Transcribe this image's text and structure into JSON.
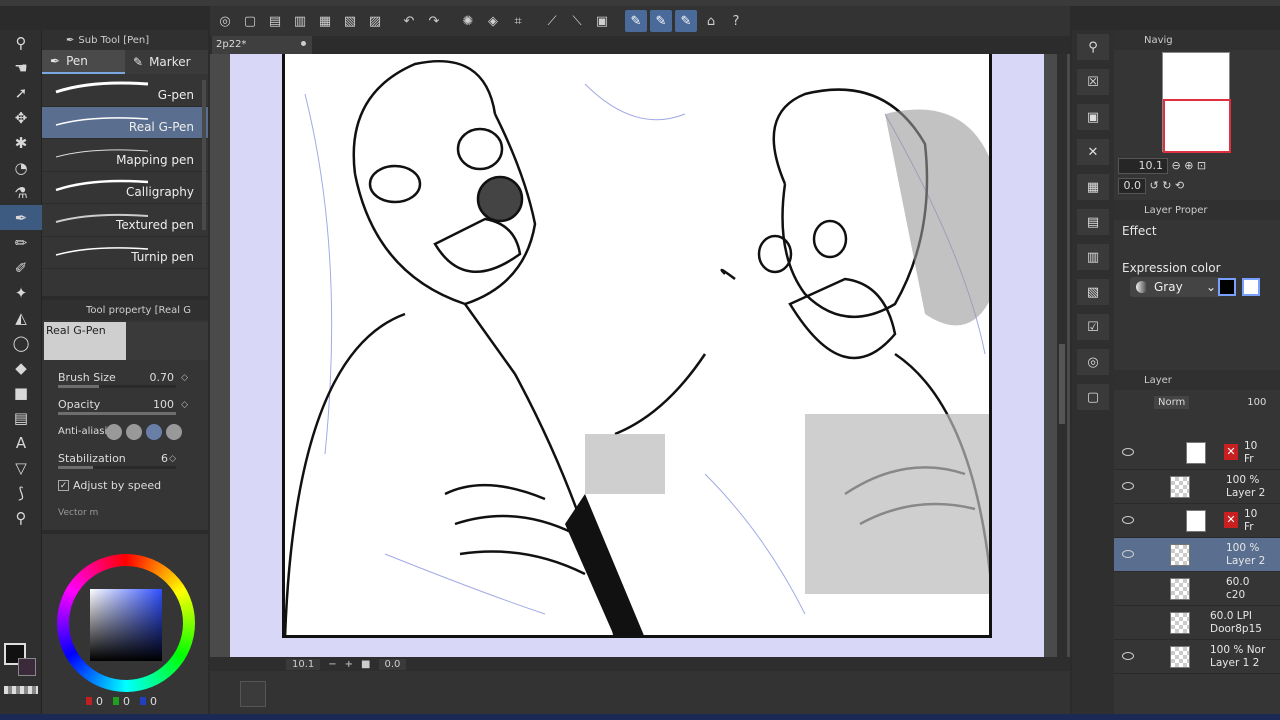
{
  "document": {
    "tab_name": "2p22*"
  },
  "subtool": {
    "title": "Sub Tool [Pen]",
    "tabs": [
      "Pen",
      "Marker"
    ],
    "brushes": [
      "G-pen",
      "Real G-Pen",
      "Mapping pen",
      "Calligraphy",
      "Textured pen",
      "Turnip pen"
    ],
    "active_brush_index": 1
  },
  "tool_property": {
    "title": "Tool property [Real G",
    "preset_name": "Real G-Pen",
    "brush_size_label": "Brush Size",
    "brush_size": "0.70",
    "brush_size_level": 0.35,
    "opacity_label": "Opacity",
    "opacity": "100",
    "opacity_level": 1.0,
    "anti_alias_label": "Anti-aliasi",
    "stabilization_label": "Stabilization",
    "stabilization": "6",
    "stabilization_level": 0.3,
    "adjust_label": "Adjust by speed",
    "vector_label": "Vector m"
  },
  "color": {
    "main": "#111111",
    "r": "0",
    "g": "0",
    "b": "0"
  },
  "status": {
    "zoom": "10.1",
    "rotation": "0.0"
  },
  "navigator": {
    "title": "Navig",
    "zoom": "10.1",
    "rotation": "0.0"
  },
  "layer_property": {
    "title": "Layer Proper",
    "effect_label": "Effect",
    "expression_label": "Expression color",
    "expression_value": "Gray"
  },
  "layers": {
    "title": "Layer",
    "blend": "Norm",
    "opacity": "100",
    "rows": [
      {
        "line1": "10",
        "line2": "Fr"
      },
      {
        "line1": "100 %",
        "line2": "Layer 2"
      },
      {
        "line1": "10",
        "line2": "Fr"
      },
      {
        "line1": "100 %",
        "line2": "Layer 2"
      },
      {
        "line1": "60.0",
        "line2": "c20"
      },
      {
        "line1": "60.0 LPI",
        "line2": "Door8p15"
      },
      {
        "line1": "100 % Nor",
        "line2": "Layer 1 2"
      }
    ],
    "active_index": 3
  }
}
